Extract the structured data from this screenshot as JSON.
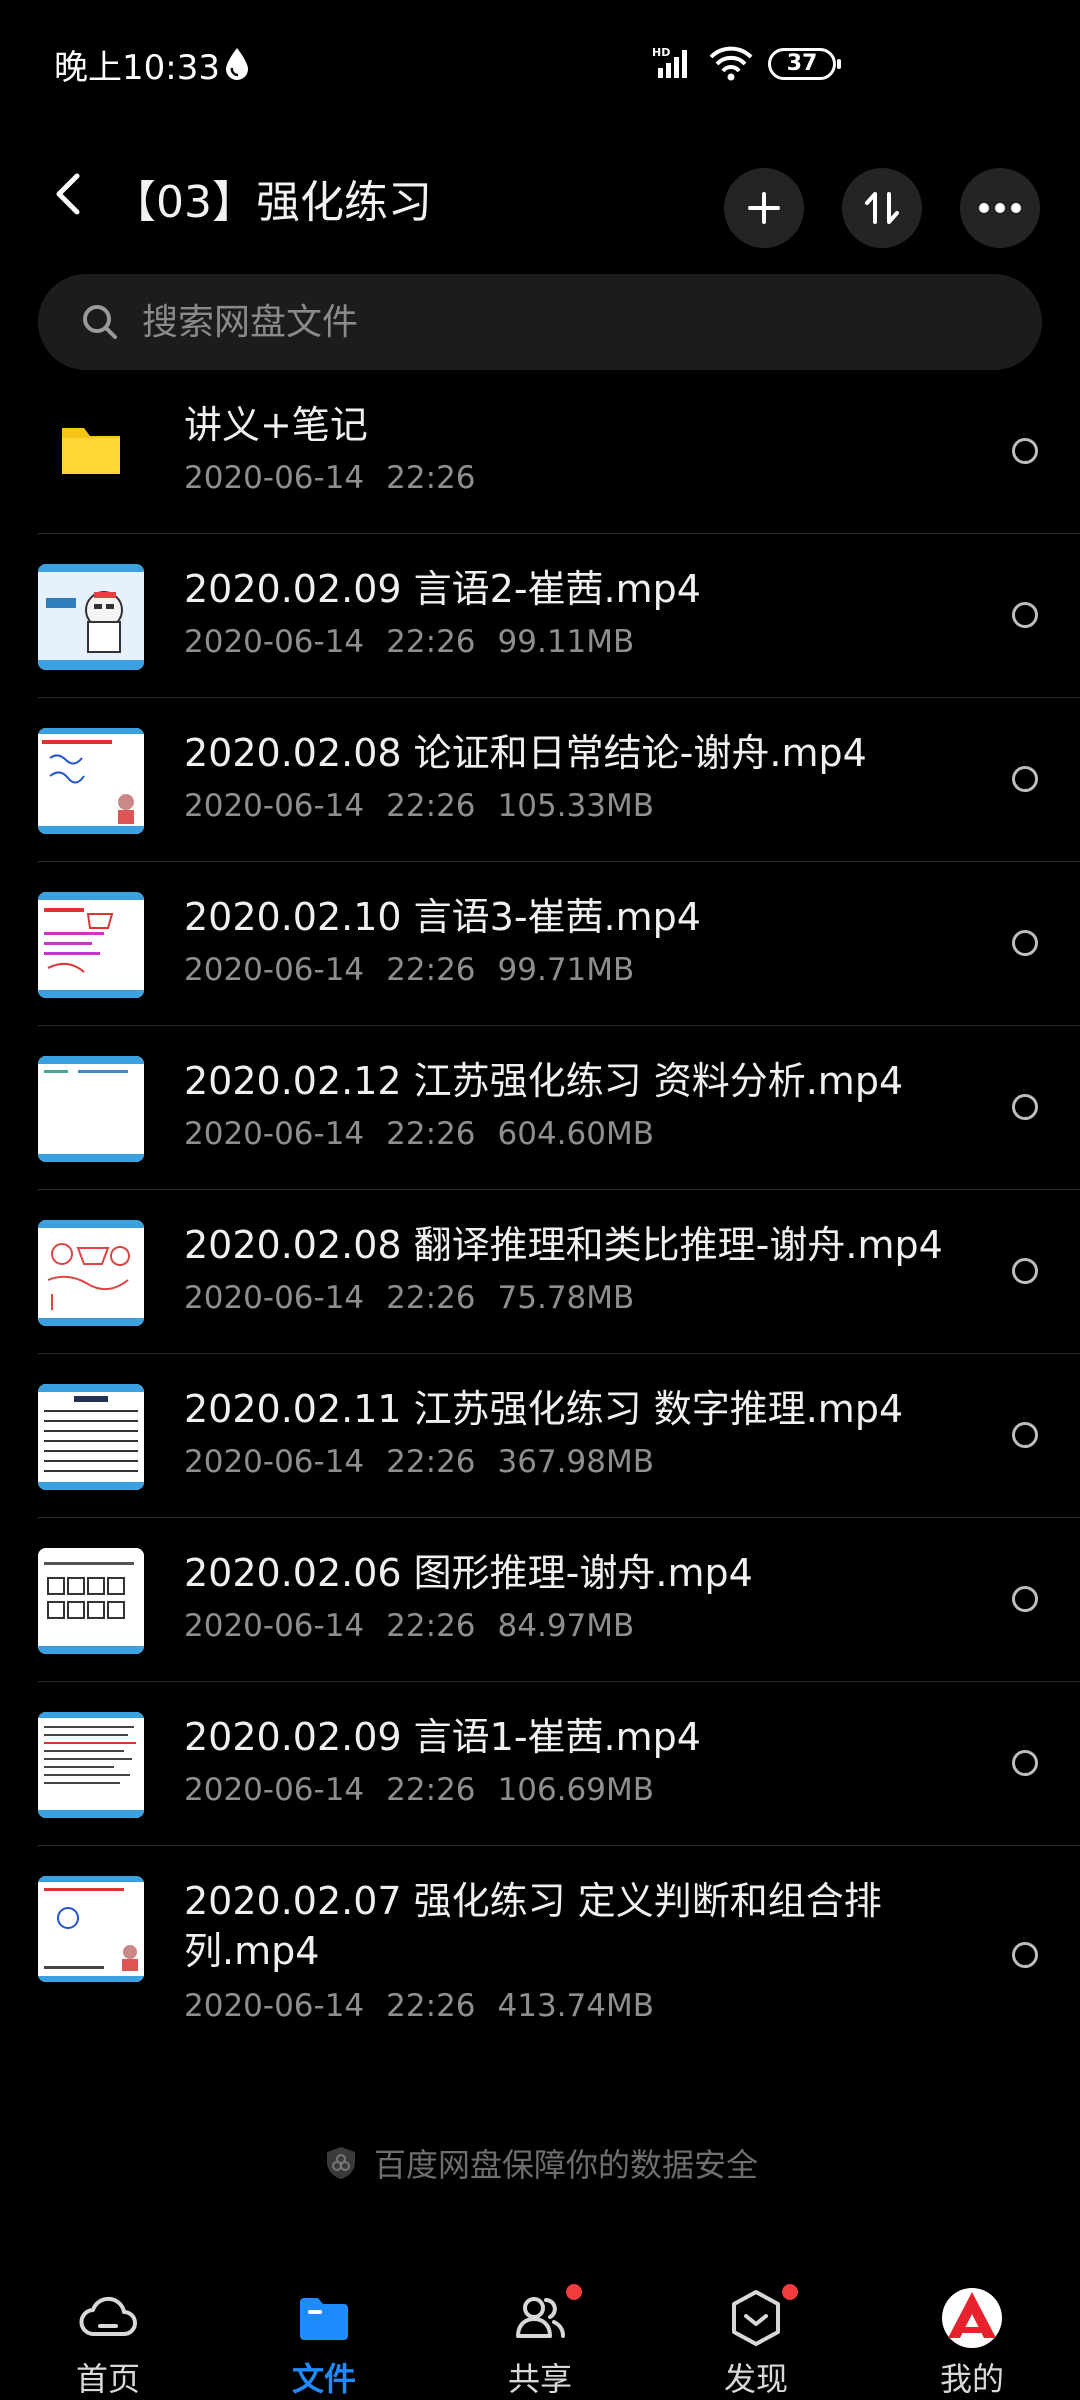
{
  "status_bar": {
    "time": "晚上10:33",
    "battery": "37",
    "network": "HD"
  },
  "header": {
    "title": "【03】强化练习"
  },
  "search": {
    "placeholder": "搜索网盘文件"
  },
  "files": [
    {
      "name": "讲义+笔记",
      "date": "2020-06-14",
      "time": "22:26",
      "size": "",
      "type": "folder"
    },
    {
      "name": "2020.02.09 言语2-崔茜.mp4",
      "date": "2020-06-14",
      "time": "22:26",
      "size": "99.11MB",
      "type": "video"
    },
    {
      "name": "2020.02.08 论证和日常结论-谢舟.mp4",
      "date": "2020-06-14",
      "time": "22:26",
      "size": "105.33MB",
      "type": "video"
    },
    {
      "name": "2020.02.10 言语3-崔茜.mp4",
      "date": "2020-06-14",
      "time": "22:26",
      "size": "99.71MB",
      "type": "video"
    },
    {
      "name": "2020.02.12 江苏强化练习 资料分析.mp4",
      "date": "2020-06-14",
      "time": "22:26",
      "size": "604.60MB",
      "type": "video"
    },
    {
      "name": "2020.02.08 翻译推理和类比推理-谢舟.mp4",
      "date": "2020-06-14",
      "time": "22:26",
      "size": "75.78MB",
      "type": "video"
    },
    {
      "name": "2020.02.11 江苏强化练习 数字推理.mp4",
      "date": "2020-06-14",
      "time": "22:26",
      "size": "367.98MB",
      "type": "video"
    },
    {
      "name": "2020.02.06 图形推理-谢舟.mp4",
      "date": "2020-06-14",
      "time": "22:26",
      "size": "84.97MB",
      "type": "video"
    },
    {
      "name": "2020.02.09 言语1-崔茜.mp4",
      "date": "2020-06-14",
      "time": "22:26",
      "size": "106.69MB",
      "type": "video"
    },
    {
      "name": "2020.02.07 强化练习 定义判断和组合排列.mp4",
      "date": "2020-06-14",
      "time": "22:26",
      "size": "413.74MB",
      "type": "video"
    }
  ],
  "security_note": "百度网盘保障你的数据安全",
  "bottom_nav": [
    {
      "label": "首页",
      "icon": "cloud-icon",
      "active": false,
      "badge": false
    },
    {
      "label": "文件",
      "icon": "folder-icon",
      "active": true,
      "badge": false
    },
    {
      "label": "共享",
      "icon": "people-icon",
      "active": false,
      "badge": true
    },
    {
      "label": "发现",
      "icon": "discover-icon",
      "active": false,
      "badge": true
    },
    {
      "label": "我的",
      "icon": "avatar-icon",
      "active": false,
      "badge": false
    }
  ],
  "colors": {
    "accent": "#1e8cff",
    "folder": "#f5c518",
    "badge": "#f03c3c",
    "background": "#000000"
  }
}
